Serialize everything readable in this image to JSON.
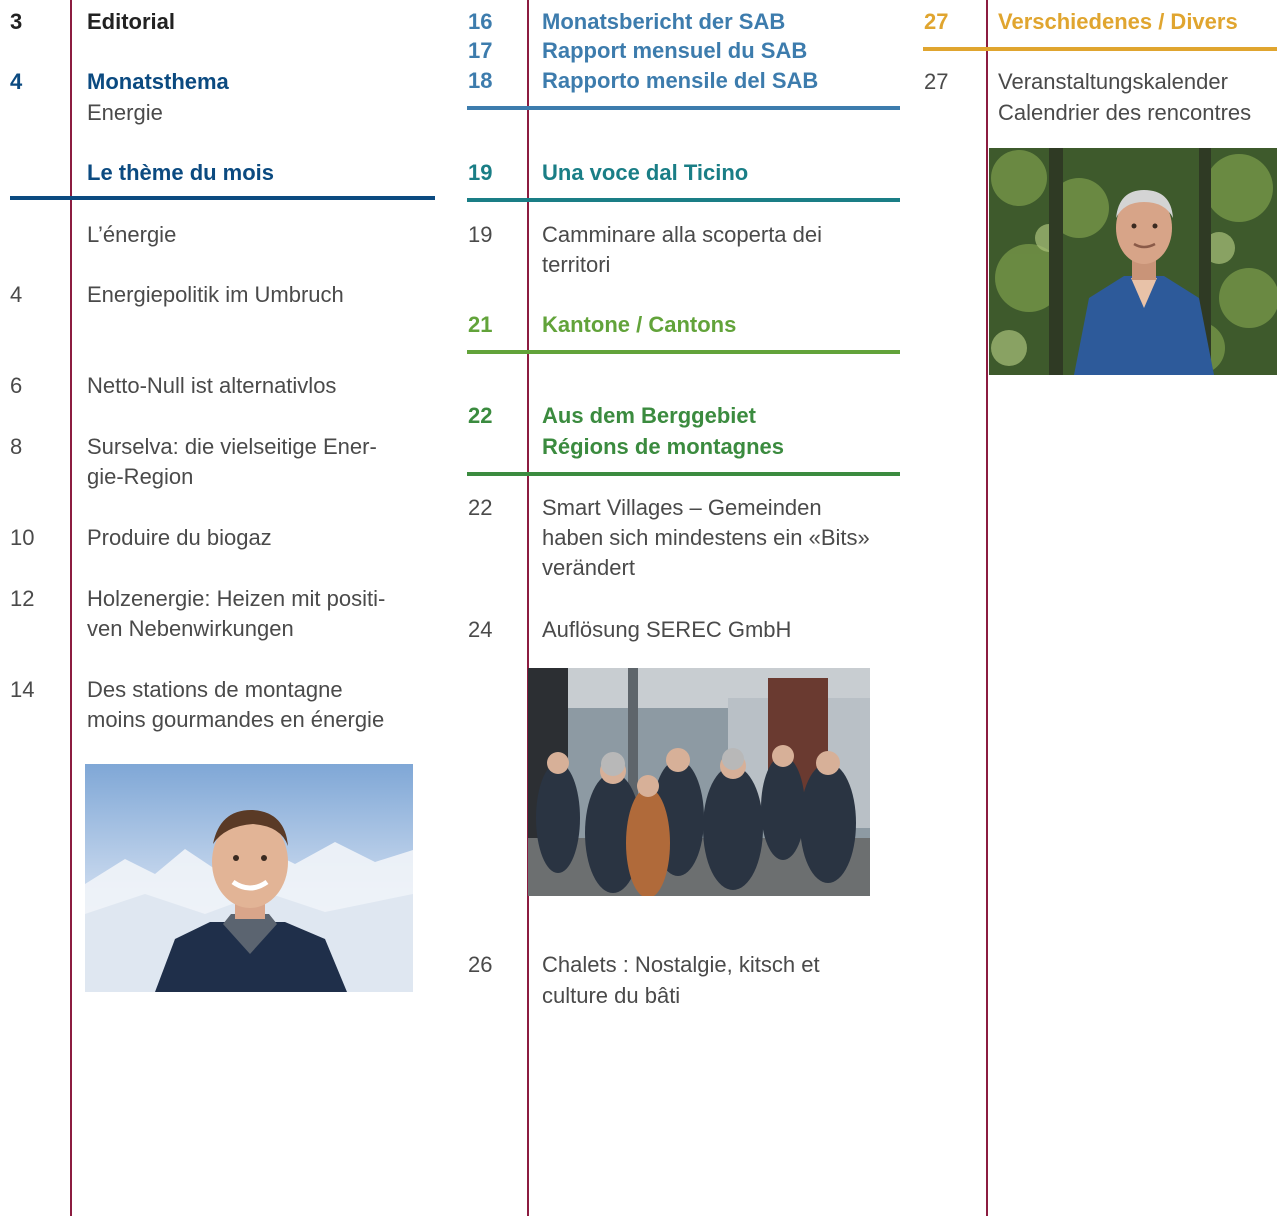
{
  "colors": {
    "rule": "#8c1c40",
    "navy": "#0b4a80",
    "blue": "#3d7cad",
    "teal": "#1a7e86",
    "green": "#62a33a",
    "darkgreen": "#3b8b3f",
    "orange": "#e0a52f",
    "text": "#3a3a3a"
  },
  "col1": {
    "editorial": {
      "num": "3",
      "title": "Editorial"
    },
    "monatsthema": {
      "num": "4",
      "title": "Monatsthema",
      "sub": "Energie"
    },
    "theme": {
      "title": "Le thème du mois",
      "sub": "L’énergie"
    },
    "items": [
      {
        "num": "4",
        "lines": [
          "Energiepolitik im Umbruch"
        ]
      },
      {
        "num": "6",
        "lines": [
          "Netto-Null ist alternativlos"
        ]
      },
      {
        "num": "8",
        "lines": [
          "Surselva: die vielseitige Ener-",
          "gie-Region"
        ]
      },
      {
        "num": "10",
        "lines": [
          "Produire du biogaz"
        ]
      },
      {
        "num": "12",
        "lines": [
          "Holzenergie: Heizen mit positi-",
          "ven Nebenwirkungen"
        ]
      },
      {
        "num": "14",
        "lines": [
          "Des stations de montagne",
          "moins gourmandes en énergie"
        ]
      }
    ]
  },
  "col2": {
    "sab": {
      "nums": [
        "16",
        "17",
        "18"
      ],
      "titles": [
        "Monatsbericht der SAB",
        "Rapport mensuel du SAB",
        "Rapporto mensile del SAB"
      ]
    },
    "ticino": {
      "num": "19",
      "title": "Una voce dal Ticino"
    },
    "ticino_item": {
      "num": "19",
      "lines": [
        "Camminare alla scoperta dei",
        "territori"
      ]
    },
    "kantone": {
      "num": "21",
      "title": "Kantone / Cantons"
    },
    "berggebiet": {
      "num": "22",
      "lines": [
        "Aus dem Berggebiet",
        "Régions de montagnes"
      ]
    },
    "items": [
      {
        "num": "22",
        "lines": [
          "Smart Villages – Gemeinden",
          "haben sich mindestens ein «Bits»",
          "verändert"
        ]
      },
      {
        "num": "24",
        "lines": [
          "Auflösung SEREC GmbH"
        ]
      },
      {
        "num": "26",
        "lines": [
          "Chalets : Nostalgie, kitsch et",
          "culture du bâti"
        ]
      }
    ]
  },
  "col3": {
    "divers": {
      "num": "27",
      "title": "Verschiedenes / Divers"
    },
    "item": {
      "num": "27",
      "lines": [
        "Veranstaltungskalender",
        "Calendrier des rencontres"
      ]
    }
  }
}
